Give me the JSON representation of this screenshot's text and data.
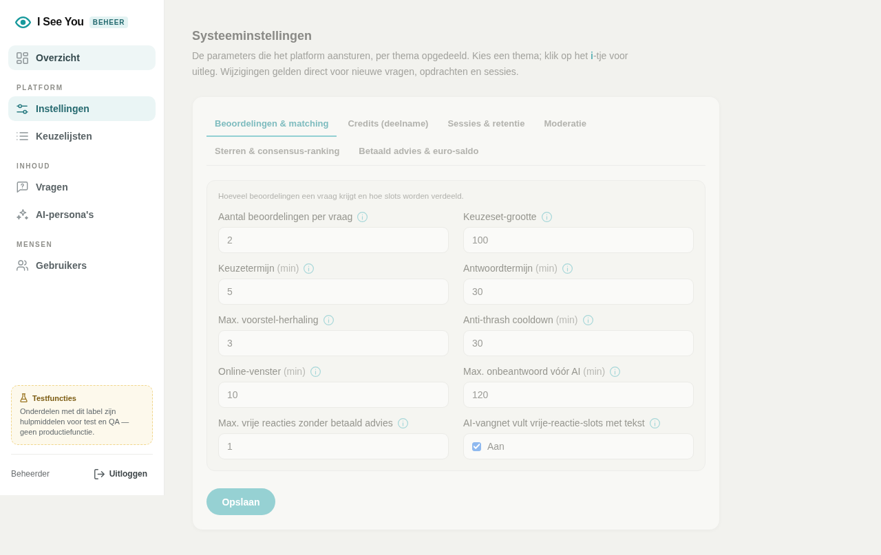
{
  "brand": {
    "name": "I See You",
    "badge": "BEHEER"
  },
  "sidebar": {
    "groups": [
      {
        "items": [
          {
            "label": "Overzicht",
            "selected": false,
            "hovered": true
          }
        ]
      },
      {
        "heading": "PLATFORM",
        "items": [
          {
            "label": "Instellingen",
            "selected": true,
            "hovered": false
          },
          {
            "label": "Keuzelijsten",
            "selected": false,
            "hovered": false
          }
        ]
      },
      {
        "heading": "INHOUD",
        "items": [
          {
            "label": "Vragen",
            "selected": false,
            "hovered": false
          },
          {
            "label": "AI-persona's",
            "selected": false,
            "hovered": false
          }
        ]
      },
      {
        "heading": "MENSEN",
        "items": [
          {
            "label": "Gebruikers",
            "selected": false,
            "hovered": false
          }
        ]
      }
    ],
    "notice": {
      "title": "Testfuncties",
      "text": "Onderdelen met dit label zijn hulpmiddelen voor test en QA — geen productiefunctie."
    },
    "footer": {
      "user": "Beheerder",
      "logout": "Uitloggen"
    }
  },
  "main": {
    "title": "Systeeminstellingen",
    "description": "De parameters die het platform aansturen, per thema opgedeeld. Kies een thema; klik op het **i**-tje voor uitleg. Wijzigingen gelden direct voor nieuwe vragen, opdrachten en sessies.",
    "tabs": [
      {
        "label": "Beoordelingen & matching",
        "selected": true
      },
      {
        "label": "Credits (deelname)",
        "selected": false
      },
      {
        "label": "Sessies & retentie",
        "selected": false
      },
      {
        "label": "Moderatie",
        "selected": false
      },
      {
        "label": "Sterren & consensus-ranking",
        "selected": false
      },
      {
        "label": "Betaald advies & euro-saldo",
        "selected": false
      }
    ],
    "panel": {
      "description": "Hoeveel beoordelingen een vraag krijgt en hoe slots worden verdeeld.",
      "fields": [
        {
          "kind": "number",
          "label": "Aantal beoordelingen per vraag",
          "value": "2"
        },
        {
          "kind": "number",
          "label": "Keuzeset-grootte",
          "value": "100"
        },
        {
          "kind": "number",
          "label": "Keuzetermijn",
          "unit": "(min)",
          "value": "5"
        },
        {
          "kind": "number",
          "label": "Antwoordtermijn",
          "unit": "(min)",
          "value": "30"
        },
        {
          "kind": "number",
          "label": "Max. voorstel-herhaling",
          "value": "3"
        },
        {
          "kind": "number",
          "label": "Anti-thrash cooldown",
          "unit": "(min)",
          "value": "30"
        },
        {
          "kind": "number",
          "label": "Online-venster",
          "unit": "(min)",
          "value": "10"
        },
        {
          "kind": "number",
          "label": "Max. onbeantwoord vóór AI",
          "unit": "(min)",
          "value": "120"
        },
        {
          "kind": "number",
          "label": "Max. vrije reacties zonder betaald advies",
          "value": "1"
        },
        {
          "kind": "checkbox",
          "label": "AI-vangnet vult vrije-reactie-slots met tekst",
          "checked": true,
          "value": "Aan"
        }
      ]
    },
    "save_button": "Opslaan"
  }
}
